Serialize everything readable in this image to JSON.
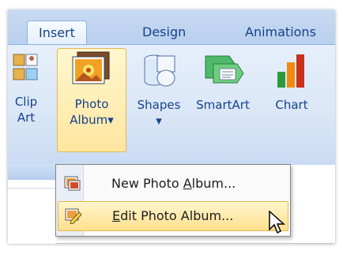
{
  "tabs": {
    "insert": "Insert",
    "design": "Design",
    "animations": "Animations"
  },
  "ribbon": {
    "clip_art": {
      "line1": "Clip",
      "line2": "Art"
    },
    "photo_album": {
      "line1": "Photo",
      "line2": "Album",
      "arrow": "▾"
    },
    "shapes": {
      "line1": "Shapes",
      "arrow": "▾"
    },
    "smartart": {
      "line1": "SmartArt"
    },
    "chart": {
      "line1": "Chart"
    }
  },
  "menu": {
    "items": [
      {
        "label_pre": "New Photo ",
        "label_acc": "A",
        "label_post": "lbum...",
        "icon": "new-photo-album-icon"
      },
      {
        "label_pre": "",
        "label_acc": "E",
        "label_post": "dit Photo Album...",
        "icon": "edit-photo-album-icon"
      }
    ]
  },
  "colors": {
    "ribbon_text": "#15428b",
    "hover_fill": "#ffe6a0",
    "hover_border": "#e6b84e"
  }
}
